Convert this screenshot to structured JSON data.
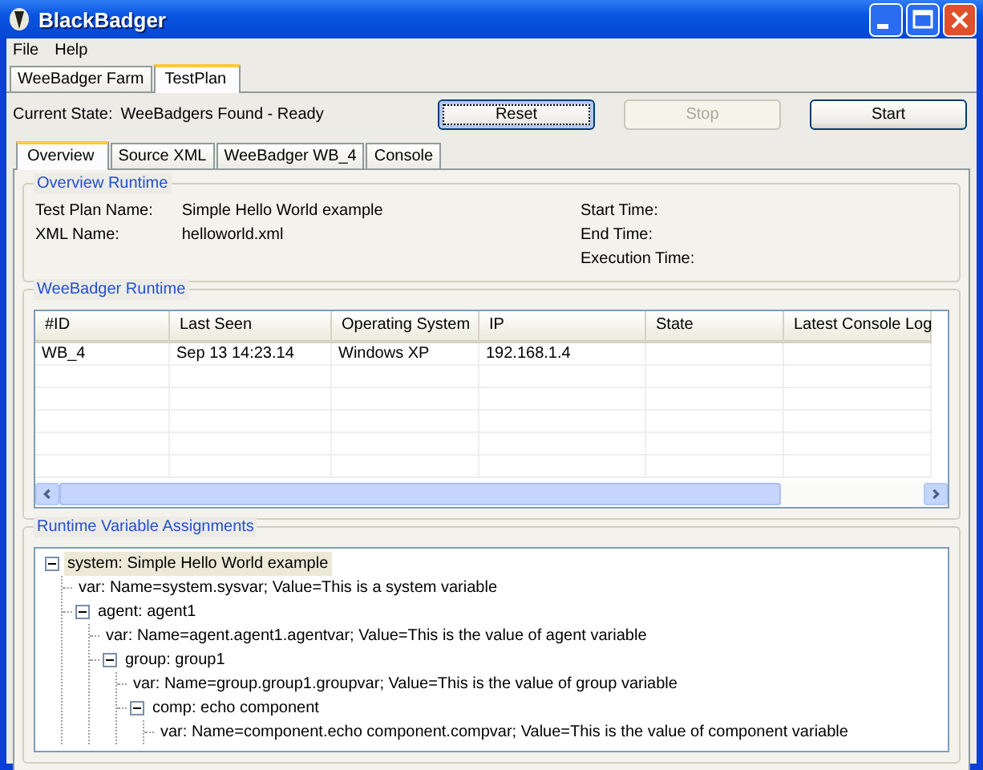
{
  "window": {
    "title": "BlackBadger"
  },
  "menu": [
    "File",
    "Help"
  ],
  "main_tabs": [
    {
      "label": "WeeBadger Farm",
      "selected": false
    },
    {
      "label": "TestPlan",
      "selected": true
    }
  ],
  "current_state": {
    "label": "Current State:",
    "value": "WeeBadgers Found - Ready"
  },
  "buttons": [
    {
      "label": "Reset",
      "disabled": false,
      "focused": true
    },
    {
      "label": "Stop",
      "disabled": true,
      "focused": false
    },
    {
      "label": "Start",
      "disabled": false,
      "focused": false
    }
  ],
  "sub_tabs": [
    {
      "label": "Overview",
      "selected": true
    },
    {
      "label": "Source XML",
      "selected": false
    },
    {
      "label": "WeeBadger WB_4",
      "selected": false
    },
    {
      "label": "Console",
      "selected": false
    }
  ],
  "overview_runtime": {
    "title": "Overview Runtime",
    "left": [
      {
        "label": "Test Plan Name:",
        "value": "Simple Hello World example"
      },
      {
        "label": "XML Name:",
        "value": "helloworld.xml"
      }
    ],
    "right": [
      {
        "label": "Start Time:"
      },
      {
        "label": "End Time:"
      },
      {
        "label": "Execution Time:"
      }
    ]
  },
  "weebadger_runtime": {
    "title": "WeeBadger Runtime",
    "columns": [
      "#ID",
      "Last Seen",
      "Operating System",
      "IP",
      "State",
      "Latest Console Log"
    ],
    "rows": [
      [
        "WB_4",
        "Sep 13 14:23.14",
        "Windows XP",
        "192.168.1.4"
      ]
    ]
  },
  "runtime_variables": {
    "title": "Runtime Variable Assignments",
    "tree": [
      {
        "label": "system: Simple Hello World example",
        "selected": true,
        "expanded": true,
        "children": [
          {
            "label": "var: Name=system.sysvar; Value=This is a system variable",
            "selected": false
          },
          {
            "label": "agent: agent1",
            "selected": false,
            "expanded": true,
            "children": [
              {
                "label": "var: Name=agent.agent1.agentvar; Value=This is the value of agent variable",
                "selected": false
              },
              {
                "label": "group: group1",
                "selected": false,
                "expanded": true,
                "children": [
                  {
                    "label": "var: Name=group.group1.groupvar; Value=This is the value of group variable",
                    "selected": false
                  },
                  {
                    "label": "comp: echo component",
                    "selected": false,
                    "expanded": true,
                    "children": [
                      {
                        "label": "var: Name=component.echo component.compvar; Value=This is the value of component variable",
                        "selected": false
                      }
                    ]
                  }
                ]
              }
            ]
          }
        ]
      }
    ]
  }
}
